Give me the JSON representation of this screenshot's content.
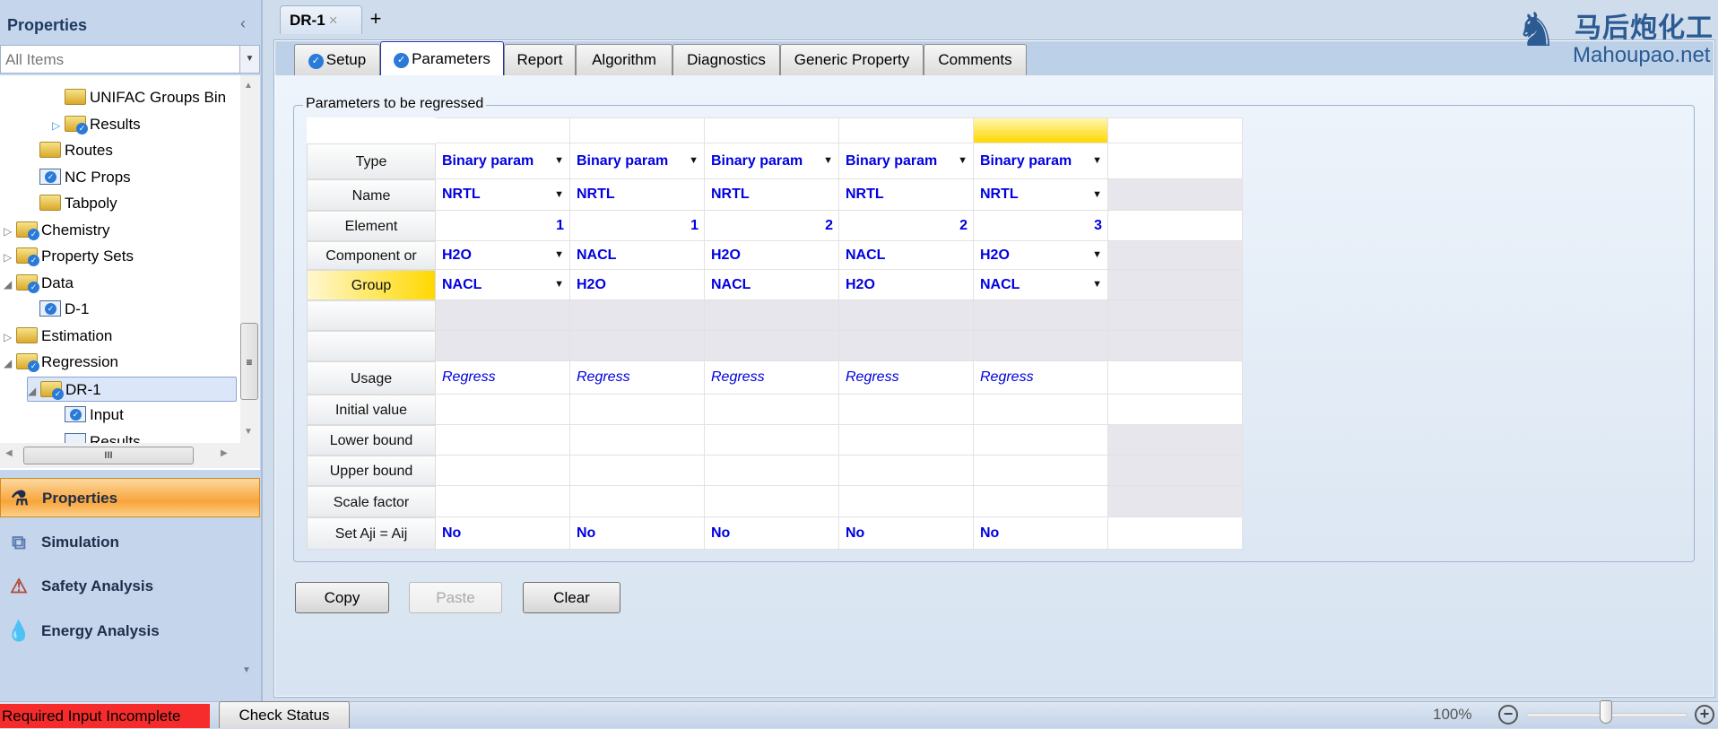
{
  "left_panel": {
    "title": "Properties",
    "filter": "All Items",
    "tree": [
      {
        "label": "UNIFAC Groups Bin",
        "icon": "folder-icon"
      },
      {
        "label": "Results",
        "icon": "folder-check-icon"
      },
      {
        "label": "Routes",
        "icon": "folder-icon"
      },
      {
        "label": "NC Props",
        "icon": "form-check-icon"
      },
      {
        "label": "Tabpoly",
        "icon": "folder-icon"
      },
      {
        "label": "Chemistry",
        "icon": "folder-check-icon"
      },
      {
        "label": "Property Sets",
        "icon": "folder-check-icon"
      },
      {
        "label": "Data",
        "icon": "folder-check-icon"
      },
      {
        "label": "D-1",
        "icon": "form-check-icon"
      },
      {
        "label": "Estimation",
        "icon": "folder-icon"
      },
      {
        "label": "Regression",
        "icon": "folder-check-icon"
      },
      {
        "label": "DR-1",
        "icon": "folder-check-icon",
        "selected": true
      },
      {
        "label": "Input",
        "icon": "form-check-icon"
      },
      {
        "label": "Results",
        "icon": "results-icon"
      }
    ],
    "nav": [
      {
        "label": "Properties",
        "icon": "flask-icon",
        "active": true
      },
      {
        "label": "Simulation",
        "icon": "flowsheet-icon"
      },
      {
        "label": "Safety Analysis",
        "icon": "safety-icon"
      },
      {
        "label": "Energy Analysis",
        "icon": "energy-icon"
      }
    ]
  },
  "doc_tab": {
    "label": "DR-1",
    "close": "×",
    "add": "+"
  },
  "logo": {
    "cn": "马后炮化工",
    "en": "Mahoupao.net"
  },
  "tabs": [
    {
      "label": "Setup",
      "check": true
    },
    {
      "label": "Parameters",
      "check": true,
      "active": true
    },
    {
      "label": "Report"
    },
    {
      "label": "Algorithm"
    },
    {
      "label": "Diagnostics"
    },
    {
      "label": "Generic Property"
    },
    {
      "label": "Comments"
    }
  ],
  "group_title": "Parameters to be regressed",
  "grid": {
    "rows": [
      {
        "label": "Type",
        "values": [
          "Binary param",
          "Binary param",
          "Binary param",
          "Binary param",
          "Binary param",
          ""
        ]
      },
      {
        "label": "Name",
        "values": [
          "NRTL",
          "NRTL",
          "NRTL",
          "NRTL",
          "NRTL",
          ""
        ]
      },
      {
        "label": "Element",
        "values": [
          "1",
          "1",
          "2",
          "2",
          "3",
          ""
        ]
      },
      {
        "label": "Component or",
        "values": [
          "H2O",
          "NACL",
          "H2O",
          "NACL",
          "H2O",
          ""
        ]
      },
      {
        "label": "Group",
        "values": [
          "NACL",
          "H2O",
          "NACL",
          "H2O",
          "NACL",
          ""
        ]
      },
      {
        "label": "",
        "values": [
          "",
          "",
          "",
          "",
          "",
          ""
        ]
      },
      {
        "label": "",
        "values": [
          "",
          "",
          "",
          "",
          "",
          ""
        ]
      },
      {
        "label": "Usage",
        "values": [
          "Regress",
          "Regress",
          "Regress",
          "Regress",
          "Regress",
          ""
        ]
      },
      {
        "label": "Initial value",
        "values": [
          "",
          "",
          "",
          "",
          "",
          ""
        ]
      },
      {
        "label": "Lower bound",
        "values": [
          "",
          "",
          "",
          "",
          "",
          ""
        ]
      },
      {
        "label": "Upper bound",
        "values": [
          "",
          "",
          "",
          "",
          "",
          ""
        ]
      },
      {
        "label": "Scale factor",
        "values": [
          "",
          "",
          "",
          "",
          "",
          ""
        ]
      },
      {
        "label": "Set Aji = Aij",
        "values": [
          "No",
          "No",
          "No",
          "No",
          "No",
          ""
        ]
      }
    ]
  },
  "buttons": {
    "copy": "Copy",
    "paste": "Paste",
    "clear": "Clear"
  },
  "status": {
    "message": "Required Input Incomplete",
    "check": "Check Status",
    "zoom": "100%",
    "zoom_level_percent": 100,
    "minus": "−",
    "plus": "+"
  },
  "colors": {
    "value_text": "#0000e0",
    "status_error": "#f62c2c",
    "active_nav": "#f8a43a",
    "selected_header": "#ffd800"
  }
}
